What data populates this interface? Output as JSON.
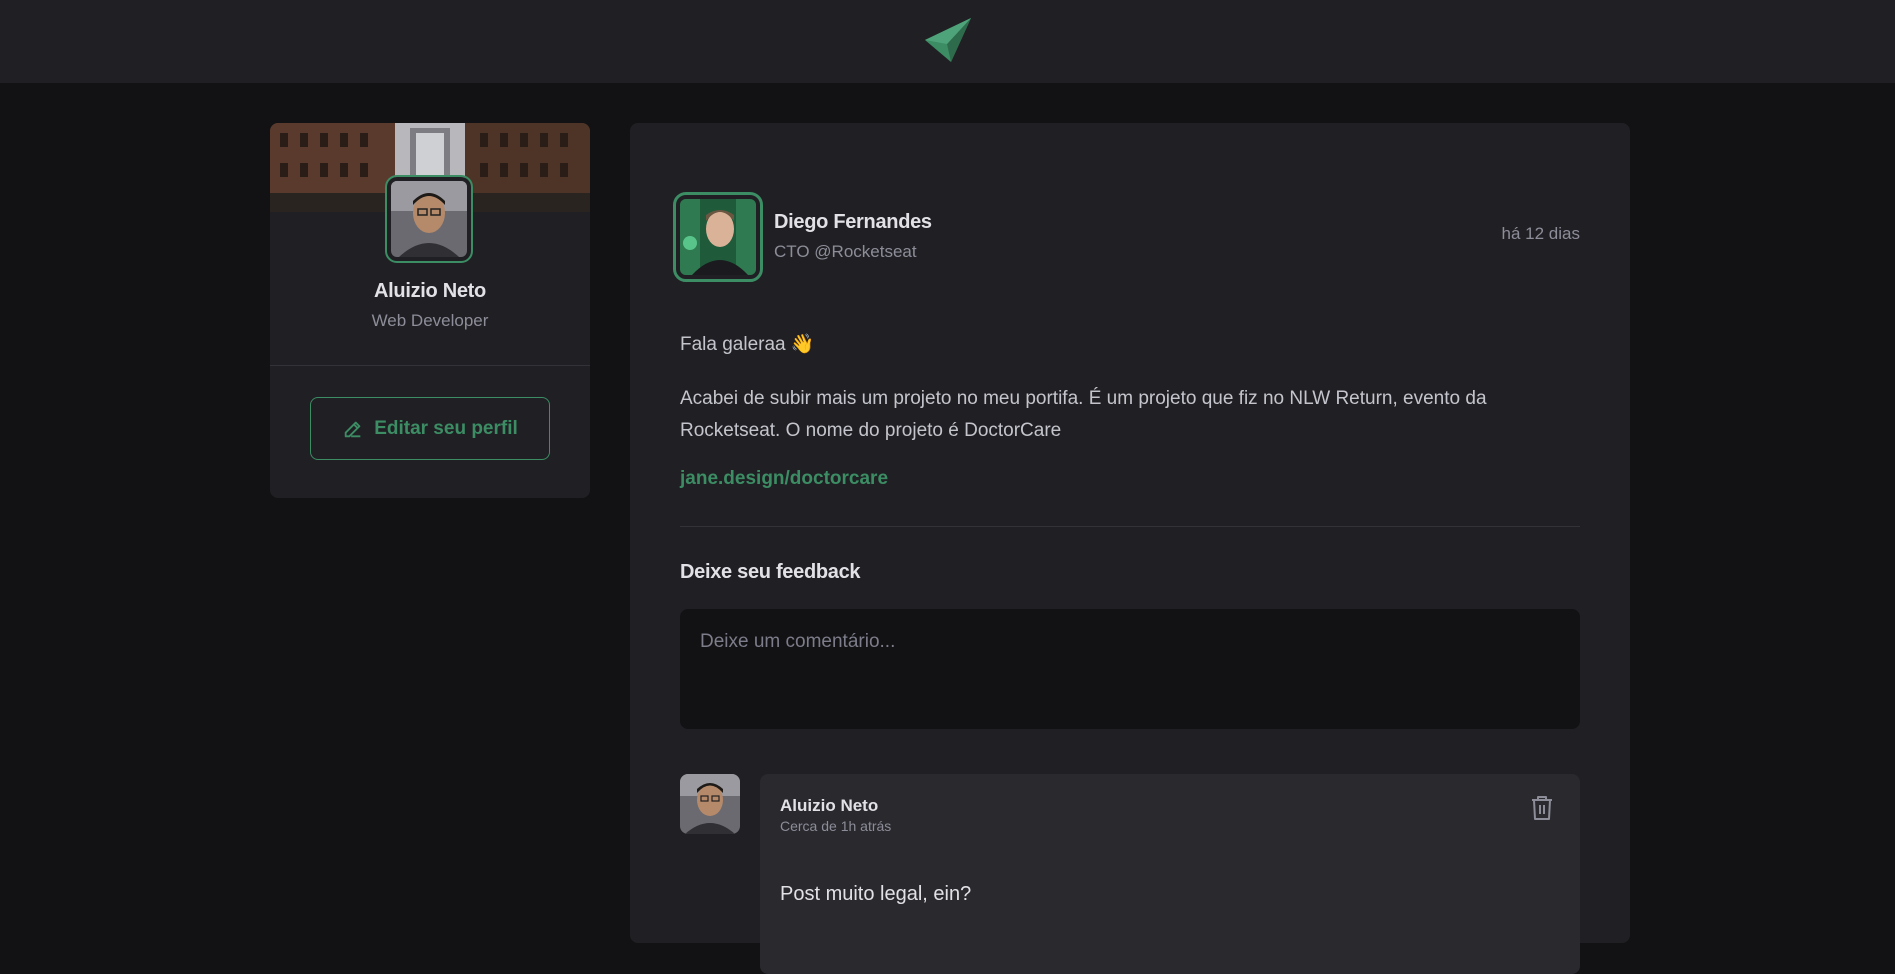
{
  "header": {
    "logo_icon": "ignite-feed-logo-icon"
  },
  "sidebar": {
    "cover_image": "city-bridge-cover",
    "avatar_icon": "user-avatar",
    "name": "Aluizio Neto",
    "role": "Web Developer",
    "edit_button": {
      "label": "Editar seu perfil",
      "icon": "pencil-icon"
    }
  },
  "post": {
    "author": {
      "name": "Diego Fernandes",
      "role": "CTO @Rocketseat",
      "avatar_icon": "author-avatar"
    },
    "time": "há 12 dias",
    "content": {
      "p1": "Fala galeraa 👋",
      "p2": "Acabei de subir mais um projeto no meu portifa. É um projeto que fiz no NLW Return, evento da Rocketseat. O nome do projeto é DoctorCare",
      "link": "jane.design/doctorcare"
    },
    "feedback": {
      "title": "Deixe seu feedback",
      "placeholder": "Deixe um comentário..."
    },
    "comments": [
      {
        "author": "Aluizio Neto",
        "time": "Cerca de 1h atrás",
        "text": "Post muito legal, ein?",
        "delete_icon": "trash-icon"
      }
    ]
  },
  "colors": {
    "background": "#121214",
    "surface": "#202024",
    "accent": "#3c8c64",
    "text": "#e1e1e6",
    "muted": "#8d8d99"
  }
}
